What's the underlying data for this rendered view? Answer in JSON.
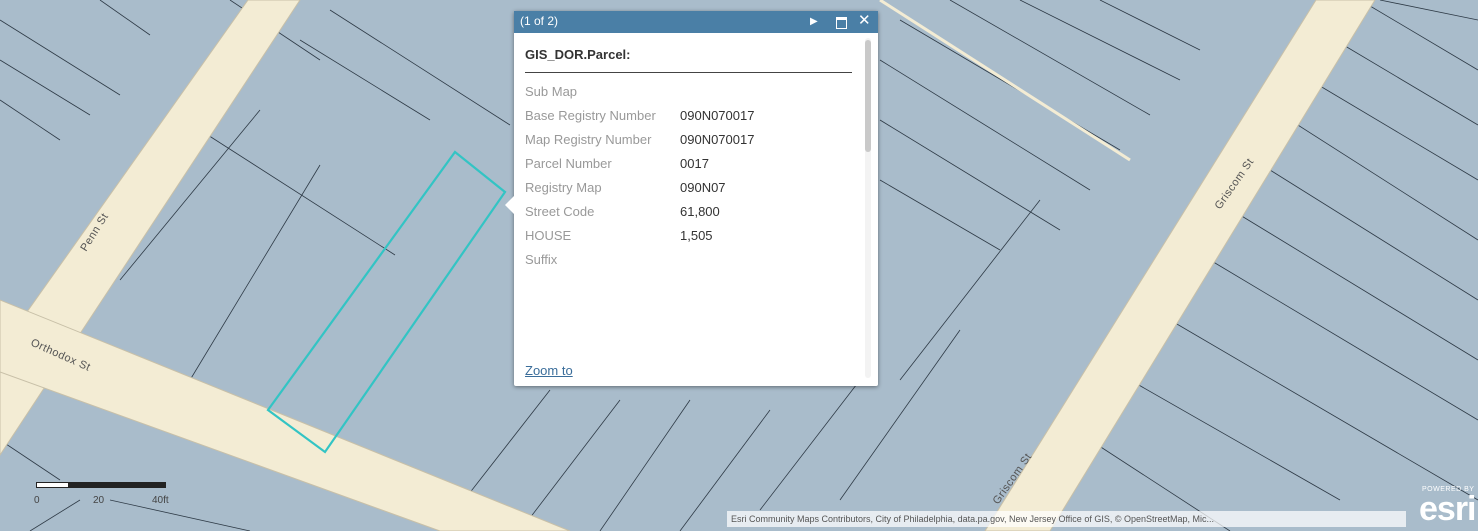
{
  "map": {
    "street_labels": {
      "penn": "Penn St",
      "orthodox": "Orthodox St",
      "griscom_upper": "Griscom St",
      "griscom_lower": "Griscom St"
    },
    "colors": {
      "parcel_fill": "#a9bccb",
      "street_fill": "#f3ecd4",
      "parcel_line": "#2e3a46",
      "selection": "#33c4c4"
    }
  },
  "popup": {
    "count": "(1 of 2)",
    "title": "GIS_DOR.Parcel:",
    "attributes": [
      {
        "label": "Sub Map",
        "value": ""
      },
      {
        "label": "Base Registry Number",
        "value": "090N070017"
      },
      {
        "label": "Map Registry Number",
        "value": "090N070017"
      },
      {
        "label": "Parcel Number",
        "value": "0017"
      },
      {
        "label": "Registry Map",
        "value": "090N07"
      },
      {
        "label": "Street Code",
        "value": "61,800"
      },
      {
        "label": "HOUSE",
        "value": "1,505"
      },
      {
        "label": "Suffix",
        "value": ""
      }
    ],
    "zoom_link": "Zoom to",
    "icons": {
      "next": "play-icon",
      "maximize": "maximize-icon",
      "close": "close-icon"
    },
    "header_color": "#4a7fa6"
  },
  "scalebar": {
    "labels": [
      "0",
      "20",
      "40ft"
    ]
  },
  "attribution": "Esri Community Maps Contributors, City of Philadelphia, data.pa.gov, New Jersey Office of GIS, © OpenStreetMap, Mic...",
  "logo": {
    "name": "esri",
    "tag": "POWERED BY"
  }
}
